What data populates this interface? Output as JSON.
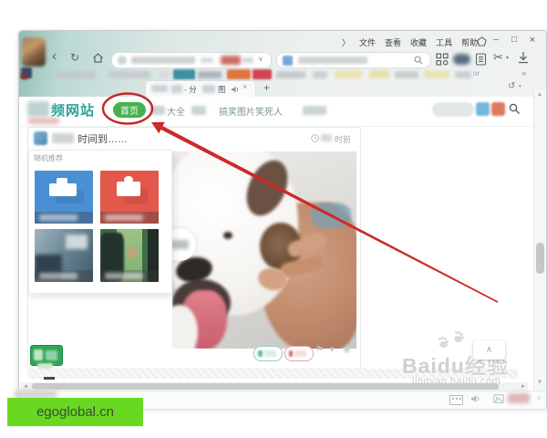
{
  "icons": {
    "menu_expander": "〉",
    "back": "‹",
    "refresh": "↻",
    "dropdown": "∨",
    "scissors": "✂",
    "caret": "▾",
    "minimize": "–",
    "maximize": "□",
    "close": "×",
    "close_tab": "×",
    "new_tab": "+",
    "restore": "↺",
    "overflow": "»",
    "up": "▲",
    "down": "▼",
    "left": "◄",
    "right": "►",
    "chevron_up": "∧",
    "chevron_down": "˅",
    "flag": "⚑",
    "heart": "♥",
    "badge": "◉"
  },
  "browser": {
    "menu_items": [
      "文件",
      "查看",
      "收藏",
      "工具",
      "帮助"
    ],
    "bookmarks_or": "or",
    "tab_title_part1": "- 分",
    "tab_title_part2": "图"
  },
  "site": {
    "logo_visible": "频网站",
    "nav_home": "首页",
    "nav_item2_suffix": "大全",
    "nav_funny": "搞笑图片笑死人"
  },
  "card": {
    "title_suffix": "时间到……",
    "time_suffix": "时前",
    "recommend_label": "随机推荐"
  },
  "watermarks": {
    "egoglobal": "egoglobal.cn",
    "baidu_brand": "Baidu",
    "baidu_product": "经验",
    "baidu_url": "jingyan.baidu.com"
  },
  "colors": {
    "annotation_red": "#c6262c",
    "nav_green": "#46b14e",
    "logo_teal": "#2fa39a",
    "watermark_green": "#68d920",
    "thumb_blue": "#4a8fd3",
    "thumb_red": "#e4574b"
  }
}
